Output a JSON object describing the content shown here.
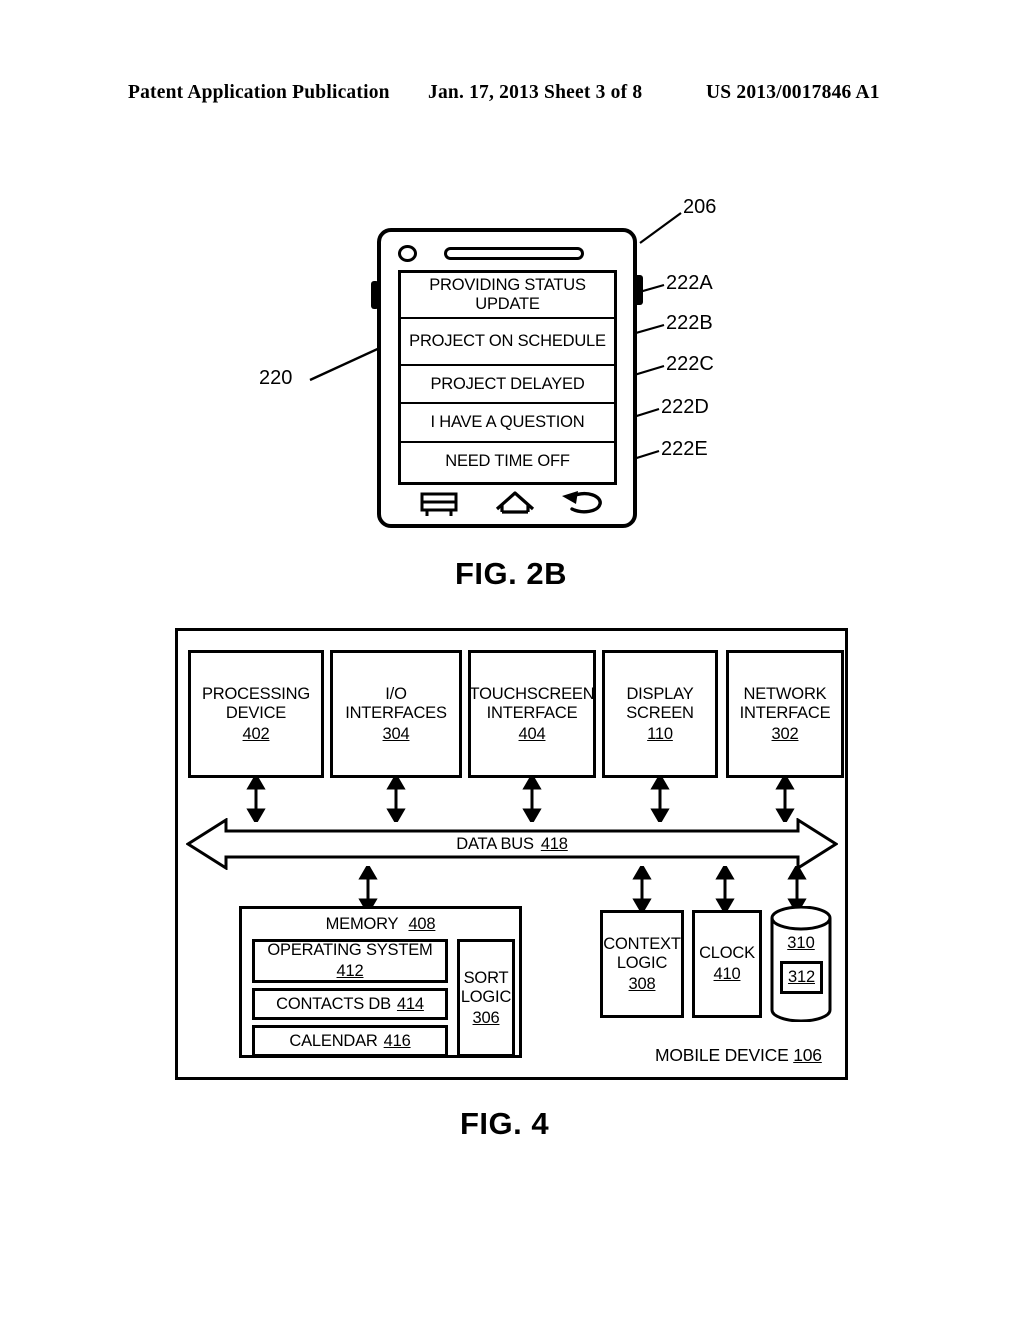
{
  "header": {
    "left": "Patent Application Publication",
    "middle": "Jan. 17, 2013  Sheet 3 of 8",
    "right": "US 2013/0017846 A1"
  },
  "fig2b": {
    "caption": "FIG. 2B",
    "device_ref": "206",
    "pointer_ref": "220",
    "menu_items": [
      {
        "label": "PROVIDING STATUS UPDATE",
        "ref": "222A",
        "lines": 2
      },
      {
        "label": "PROJECT ON SCHEDULE",
        "ref": "222B",
        "lines": 2
      },
      {
        "label": "PROJECT DELAYED",
        "ref": "222C",
        "lines": 1
      },
      {
        "label": "I HAVE A QUESTION",
        "ref": "222D",
        "lines": 1
      },
      {
        "label": "NEED TIME OFF",
        "ref": "222E",
        "lines": 1
      }
    ],
    "nav": [
      {
        "icon": "menu-icon"
      },
      {
        "icon": "home-icon"
      },
      {
        "icon": "back-icon"
      }
    ]
  },
  "fig4": {
    "caption": "FIG. 4",
    "enclosure_label": "MOBILE DEVICE",
    "enclosure_ref": "106",
    "top_row": [
      {
        "line1": "PROCESSING",
        "line2": "DEVICE",
        "ref": "402"
      },
      {
        "line1": "I/O",
        "line2": "INTERFACES",
        "ref": "304"
      },
      {
        "line1": "TOUCHSCREEN",
        "line2": "INTERFACE",
        "ref": "404"
      },
      {
        "line1": "DISPLAY",
        "line2": "SCREEN",
        "ref": "110"
      },
      {
        "line1": "NETWORK",
        "line2": "INTERFACE",
        "ref": "302"
      }
    ],
    "bus": {
      "label": "DATA BUS",
      "ref": "418"
    },
    "memory": {
      "title": "MEMORY",
      "ref": "408",
      "items": [
        {
          "line1": "OPERATING SYSTEM",
          "ref": "412",
          "stacked": true
        },
        {
          "line1": "CONTACTS DB",
          "ref": "414",
          "stacked": false
        },
        {
          "line1": "CALENDAR",
          "ref": "416",
          "stacked": false
        }
      ]
    },
    "sort_logic": {
      "line1": "SORT",
      "line2": "LOGIC",
      "ref": "306"
    },
    "context_logic": {
      "line1": "CONTEXT",
      "line2": "LOGIC",
      "ref": "308"
    },
    "clock": {
      "line1": "CLOCK",
      "ref": "410"
    },
    "database": {
      "top_ref": "310",
      "inner_ref": "312"
    }
  }
}
